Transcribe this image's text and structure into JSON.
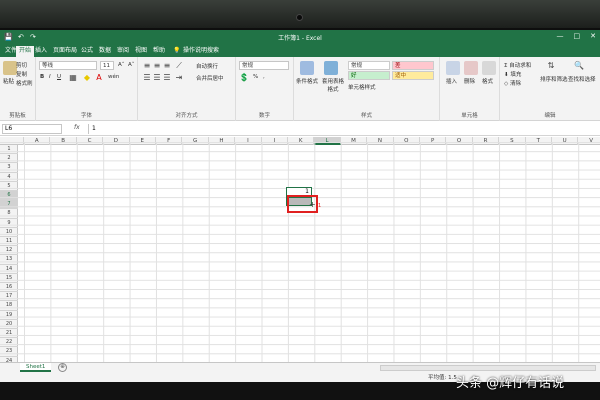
{
  "window": {
    "title": "工作簿1 - Excel",
    "controls": [
      "—",
      "□",
      "✕"
    ]
  },
  "quick_access": [
    "💾",
    "↶",
    "↷"
  ],
  "tabs": [
    {
      "label": "文件"
    },
    {
      "label": "开始"
    },
    {
      "label": "插入"
    },
    {
      "label": "页面布局"
    },
    {
      "label": "公式"
    },
    {
      "label": "数据"
    },
    {
      "label": "审阅"
    },
    {
      "label": "视图"
    },
    {
      "label": "帮助"
    },
    {
      "label": "💡"
    },
    {
      "label": "操作说明搜索"
    }
  ],
  "active_tab": "开始",
  "ribbon": {
    "clipboard": {
      "group_label": "剪贴板",
      "paste_label": "粘贴",
      "cut_label": "剪切",
      "copy_label": "复制",
      "format_painter_label": "格式刷"
    },
    "font": {
      "group_label": "字体",
      "font_name": "等线",
      "font_size": "11",
      "grow_font": "A˄",
      "shrink_font": "A˅",
      "bold": "B",
      "italic": "I",
      "underline": "U",
      "wen": "wén"
    },
    "alignment": {
      "group_label": "对齐方式",
      "wrap_text_label": "自动换行",
      "merge_label": "合并后居中"
    },
    "number": {
      "group_label": "数字",
      "format_value": "常规",
      "percent": "%",
      "comma": ","
    },
    "styles": {
      "group_label": "样式",
      "conditional_format_label": "条件格式",
      "table_format_label": "套用表格格式",
      "cell_style_label": "单元格样式",
      "style_normal": "常规",
      "style_bad": "差",
      "style_good": "好",
      "style_neutral": "适中"
    },
    "cells": {
      "group_label": "单元格",
      "insert_label": "插入",
      "delete_label": "删除",
      "format_label": "格式"
    },
    "editing": {
      "group_label": "编辑",
      "autosum_label": "自动求和",
      "fill_label": "填充",
      "clear_label": "清除",
      "sort_filter_label": "排序和筛选",
      "find_select_label": "查找和选择"
    }
  },
  "formula_bar": {
    "name_box": "L6",
    "fx": "fx",
    "value": "1"
  },
  "columns": [
    "A",
    "B",
    "C",
    "D",
    "E",
    "F",
    "G",
    "H",
    "I",
    "J",
    "K",
    "L",
    "M",
    "N",
    "O",
    "P",
    "Q",
    "R",
    "S",
    "T",
    "U",
    "V",
    "W"
  ],
  "selected_column": "L",
  "rows": [
    "1",
    "2",
    "3",
    "4",
    "5",
    "6",
    "7",
    "8",
    "9",
    "10",
    "11",
    "12",
    "13",
    "14",
    "15",
    "16",
    "17",
    "18",
    "19",
    "20",
    "21",
    "22",
    "23",
    "24",
    "25",
    "26"
  ],
  "selected_rows": [
    "6",
    "7"
  ],
  "cell_L6_value": "1",
  "fill_tooltip": "1",
  "sheet": {
    "name": "Sheet1",
    "add_symbol": "⊕"
  },
  "status": {
    "average": "平均值: 1.5"
  },
  "watermark": "头条 @辉仔有话说",
  "colors": {
    "accent": "#217346",
    "highlight": "#e02020"
  }
}
